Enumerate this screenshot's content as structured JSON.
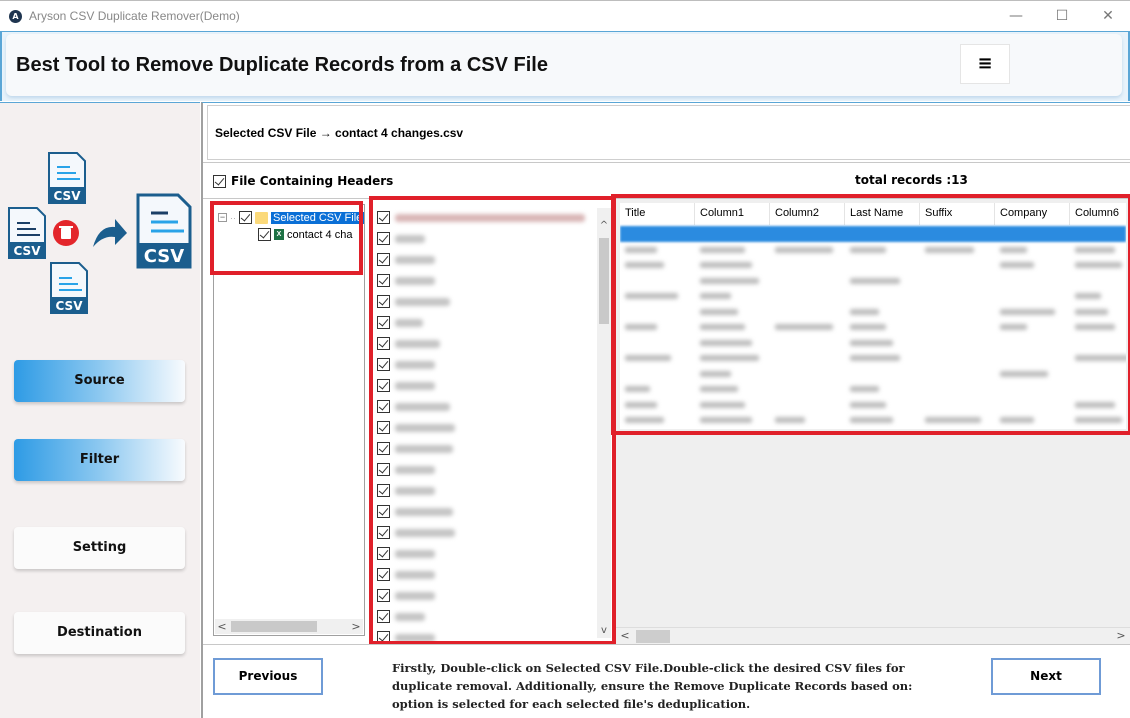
{
  "window": {
    "title": "Aryson CSV Duplicate Remover(Demo)",
    "app_icon": "aryson-logo-icon",
    "controls": {
      "minimize": "—",
      "maximize": "☐",
      "close": "✕"
    }
  },
  "header": {
    "heading": "Best Tool to Remove Duplicate Records from a CSV File",
    "menu_icon": "≡"
  },
  "sidebar": {
    "illustration": {
      "file_label": "CSV",
      "icons": [
        "csv-file-icon",
        "trash-icon",
        "arrow-icon",
        "csv-file-icon"
      ]
    },
    "nav": [
      {
        "label": "Source",
        "state": "active"
      },
      {
        "label": "Filter",
        "state": "active"
      },
      {
        "label": "Setting",
        "state": "inactive"
      },
      {
        "label": "Destination",
        "state": "inactive"
      }
    ]
  },
  "main": {
    "selected_file_label": "Selected CSV File → contact 4 changes.csv",
    "headers_checkbox": {
      "label": "File Containing Headers",
      "checked": true
    },
    "total_records": "total records :13",
    "tree": {
      "root": {
        "label": "Selected CSV File",
        "checked": true,
        "expander": "−"
      },
      "children": [
        {
          "label": "contact 4 cha",
          "checked": true,
          "icon": "X"
        }
      ]
    },
    "columns_list": {
      "item_count_visible": 21,
      "all_checked": true,
      "note": "column names are blurred in screenshot"
    },
    "grid": {
      "columns": [
        "Title",
        "Column1",
        "Column2",
        "Last Name",
        "Suffix",
        "Company",
        "Column6"
      ],
      "row_count": 13,
      "selected_row": 0
    },
    "scroll": {
      "left": "<",
      "right": ">",
      "up": "^",
      "down": "v"
    }
  },
  "footer": {
    "previous": "Previous",
    "next": "Next",
    "instructions": "Firstly, Double-click on Selected CSV File.Double-click the desired CSV files for duplicate removal. Additionally, ensure the Remove Duplicate Records based on: option is selected for each selected file's deduplication."
  },
  "colors": {
    "highlight_red": "#e0202a",
    "accent_blue": "#2e9be5",
    "selection_blue": "#0a6fd6",
    "button_border": "#6f9bd6"
  }
}
